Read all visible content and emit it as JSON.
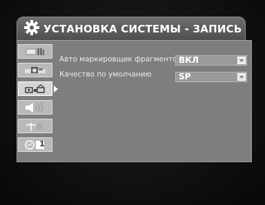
{
  "header": {
    "title": "УСТАНОВКА СИСТЕМЫ - ЗАПИСЬ",
    "icon": "gear-icon"
  },
  "nav": {
    "items": [
      {
        "id": "video",
        "icon": "video-settings-icon",
        "active": false
      },
      {
        "id": "picture",
        "icon": "camera-icon",
        "active": false
      },
      {
        "id": "recording",
        "icon": "recording-icon",
        "active": true
      },
      {
        "id": "audio",
        "icon": "speaker-icon",
        "active": false
      },
      {
        "id": "antenna",
        "icon": "antenna-icon",
        "active": false
      },
      {
        "id": "clock",
        "icon": "clock-icon",
        "badge": "1",
        "active": false
      }
    ]
  },
  "settings": {
    "rows": [
      {
        "label": "Авто маркировщик фрагментов",
        "value": "ВКЛ"
      },
      {
        "label": "Качество по умолчанию",
        "value": "SP"
      }
    ]
  },
  "colors": {
    "panel": "#7e7e7e",
    "title_bar": "#5f5f5f",
    "nav_item": "#b9b9b9",
    "background": "#121212"
  }
}
